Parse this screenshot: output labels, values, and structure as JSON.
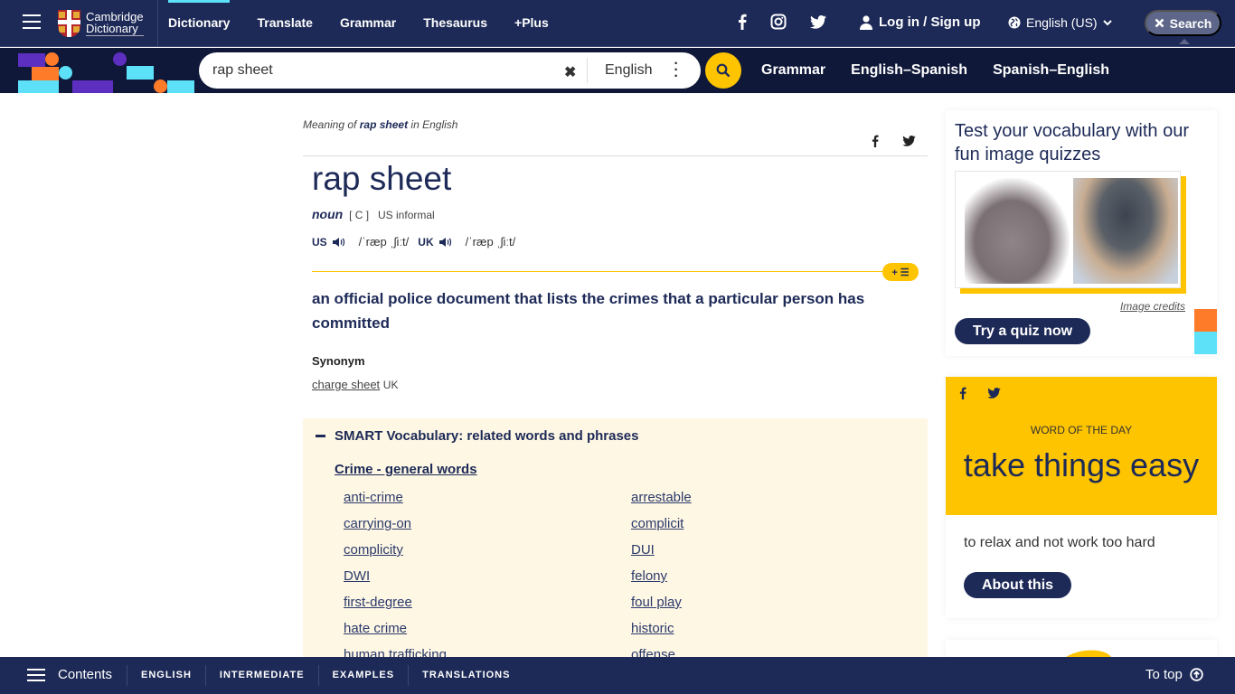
{
  "header": {
    "logo": {
      "line1": "Cambridge",
      "line2": "Dictionary"
    },
    "nav": [
      {
        "label": "Dictionary",
        "active": true
      },
      {
        "label": "Translate",
        "active": false
      },
      {
        "label": "Grammar",
        "active": false
      },
      {
        "label": "Thesaurus",
        "active": false
      },
      {
        "label": "+Plus",
        "active": false
      }
    ],
    "social": [
      "facebook-icon",
      "instagram-icon",
      "twitter-icon"
    ],
    "login_label": "Log in / Sign up",
    "language_label": "English (US)",
    "search_toggle_label": "Search"
  },
  "searchbar": {
    "query": "rap sheet",
    "dictionary": "English",
    "subnav": [
      "Grammar",
      "English–Spanish",
      "Spanish–English"
    ]
  },
  "entry": {
    "meaning_prefix": "Meaning of",
    "meaning_word": "rap sheet",
    "meaning_suffix": "in English",
    "headword": "rap sheet",
    "pos": "noun",
    "grammar": "[ C ]",
    "usage": "US informal",
    "pronunciations": [
      {
        "region": "US",
        "ipa": "/ˈræp ˌʃiːt/"
      },
      {
        "region": "UK",
        "ipa": "/ˈræp ˌʃiːt/"
      }
    ],
    "add_to_list_label": "+ ☰",
    "definition": "an official police document that lists the crimes that a particular person has committed",
    "synonym_heading": "Synonym",
    "synonym": "charge sheet",
    "synonym_region": "UK"
  },
  "smart_vocab": {
    "heading": "SMART Vocabulary: related words and phrases",
    "topic": "Crime - general words",
    "words": [
      "anti-crime",
      "arrestable",
      "carrying-on",
      "complicit",
      "complicity",
      "DUI",
      "DWI",
      "felony",
      "first-degree",
      "foul play",
      "hate crime",
      "historic",
      "human trafficking",
      "offense"
    ]
  },
  "sidebar": {
    "quiz": {
      "title": "Test your vocabulary with our fun image quizzes",
      "credits": "Image credits",
      "button": "Try a quiz now"
    },
    "wotd": {
      "label": "WORD OF THE DAY",
      "word": "take things easy",
      "definition": "to relax and not work too hard",
      "button": "About this"
    }
  },
  "bottombar": {
    "contents_label": "Contents",
    "tabs": [
      "ENGLISH",
      "INTERMEDIATE",
      "EXAMPLES",
      "TRANSLATIONS"
    ],
    "to_top_label": "To top"
  },
  "colors": {
    "navy": "#1d2a57",
    "dark_navy": "#0f1839",
    "yellow": "#fec400",
    "cyan": "#5ce1f8",
    "orange": "#fe7b2a",
    "purple": "#5d2fc1",
    "smart_bg": "#fef7e4"
  }
}
